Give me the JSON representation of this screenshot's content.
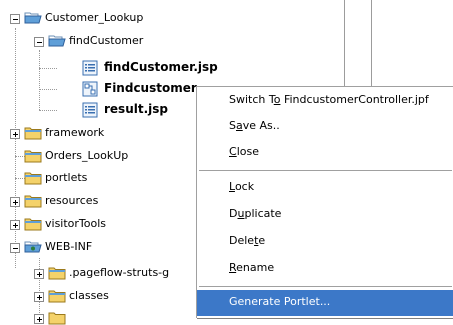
{
  "tree": {
    "customer_lookup": "Customer_Lookup",
    "find_customer": "findCustomer",
    "find_customer_jsp": "findCustomer.jsp",
    "find_customer_controller": "Findcustomer",
    "result_jsp": "result.jsp",
    "framework": "framework",
    "orders_lookup": "Orders_LookUp",
    "portlets": "portlets",
    "resources": "resources",
    "visitor_tools": "visitorTools",
    "web_inf": "WEB-INF",
    "pageflow_struts": ".pageflow-struts-g",
    "classes": "classes"
  },
  "context_menu": {
    "items": [
      {
        "pre": "Switch T",
        "mn": "o",
        "post": " FindcustomerController.jpf"
      },
      {
        "pre": "S",
        "mn": "a",
        "post": "ve As.."
      },
      {
        "pre": "",
        "mn": "C",
        "post": "lose"
      },
      {
        "pre": "",
        "mn": "L",
        "post": "ock"
      },
      {
        "pre": "D",
        "mn": "u",
        "post": "plicate"
      },
      {
        "pre": "Dele",
        "mn": "t",
        "post": "e"
      },
      {
        "pre": "",
        "mn": "R",
        "post": "ename"
      },
      {
        "pre": "Generate Portlet...",
        "mn": "",
        "post": ""
      }
    ]
  },
  "icons": {
    "folder": "folder-icon",
    "open_folder": "folder-open-icon",
    "web_folder": "web-folder-icon",
    "jsp_file": "jsp-file-icon",
    "controller_file": "pageflow-controller-icon",
    "expand": "plus-icon",
    "collapse": "minus-icon"
  },
  "colors": {
    "selection": "#3c78c8",
    "folder": "#f4d26a",
    "folder_open": "#5f9fd8"
  }
}
